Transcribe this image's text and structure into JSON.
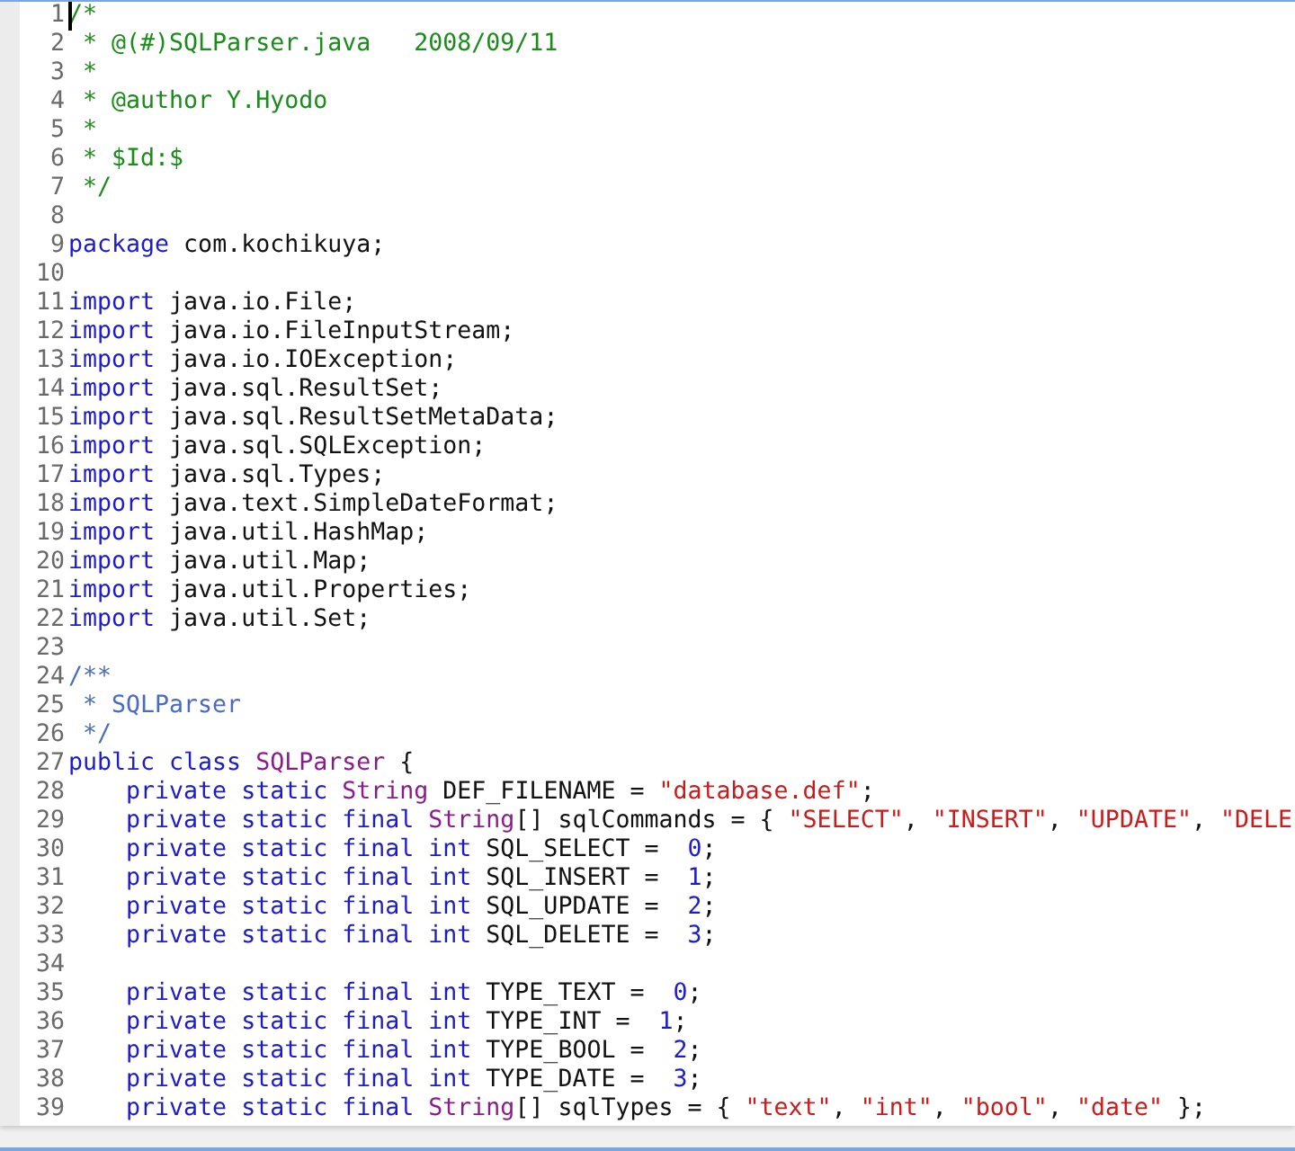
{
  "editor": {
    "caret": true,
    "lines": [
      {
        "number": "1",
        "tokens": [
          {
            "kind": "comment",
            "text": "/*"
          }
        ]
      },
      {
        "number": "2",
        "tokens": [
          {
            "kind": "comment",
            "text": " * @(#)SQLParser.java   2008/09/11"
          }
        ]
      },
      {
        "number": "3",
        "tokens": [
          {
            "kind": "comment",
            "text": " *"
          }
        ]
      },
      {
        "number": "4",
        "tokens": [
          {
            "kind": "comment",
            "text": " * @author Y.Hyodo"
          }
        ]
      },
      {
        "number": "5",
        "tokens": [
          {
            "kind": "comment",
            "text": " *"
          }
        ]
      },
      {
        "number": "6",
        "tokens": [
          {
            "kind": "comment",
            "text": " * $Id:$"
          }
        ]
      },
      {
        "number": "7",
        "tokens": [
          {
            "kind": "comment",
            "text": " */"
          }
        ]
      },
      {
        "number": "8"
      },
      {
        "number": "9",
        "tokens": [
          {
            "kind": "keyword",
            "text": "package"
          },
          {
            "kind": "plain",
            "text": " com.kochikuya;"
          }
        ]
      },
      {
        "number": "10"
      },
      {
        "number": "11",
        "tokens": [
          {
            "kind": "keyword",
            "text": "import"
          },
          {
            "kind": "plain",
            "text": " java.io.File;"
          }
        ]
      },
      {
        "number": "12",
        "tokens": [
          {
            "kind": "keyword",
            "text": "import"
          },
          {
            "kind": "plain",
            "text": " java.io.FileInputStream;"
          }
        ]
      },
      {
        "number": "13",
        "tokens": [
          {
            "kind": "keyword",
            "text": "import"
          },
          {
            "kind": "plain",
            "text": " java.io.IOException;"
          }
        ]
      },
      {
        "number": "14",
        "tokens": [
          {
            "kind": "keyword",
            "text": "import"
          },
          {
            "kind": "plain",
            "text": " java.sql.ResultSet;"
          }
        ]
      },
      {
        "number": "15",
        "tokens": [
          {
            "kind": "keyword",
            "text": "import"
          },
          {
            "kind": "plain",
            "text": " java.sql.ResultSetMetaData;"
          }
        ]
      },
      {
        "number": "16",
        "tokens": [
          {
            "kind": "keyword",
            "text": "import"
          },
          {
            "kind": "plain",
            "text": " java.sql.SQLException;"
          }
        ]
      },
      {
        "number": "17",
        "tokens": [
          {
            "kind": "keyword",
            "text": "import"
          },
          {
            "kind": "plain",
            "text": " java.sql.Types;"
          }
        ]
      },
      {
        "number": "18",
        "tokens": [
          {
            "kind": "keyword",
            "text": "import"
          },
          {
            "kind": "plain",
            "text": " java.text.SimpleDateFormat;"
          }
        ]
      },
      {
        "number": "19",
        "tokens": [
          {
            "kind": "keyword",
            "text": "import"
          },
          {
            "kind": "plain",
            "text": " java.util.HashMap;"
          }
        ]
      },
      {
        "number": "20",
        "tokens": [
          {
            "kind": "keyword",
            "text": "import"
          },
          {
            "kind": "plain",
            "text": " java.util.Map;"
          }
        ]
      },
      {
        "number": "21",
        "tokens": [
          {
            "kind": "keyword",
            "text": "import"
          },
          {
            "kind": "plain",
            "text": " java.util.Properties;"
          }
        ]
      },
      {
        "number": "22",
        "tokens": [
          {
            "kind": "keyword",
            "text": "import"
          },
          {
            "kind": "plain",
            "text": " java.util.Set;"
          }
        ]
      },
      {
        "number": "23"
      },
      {
        "number": "24",
        "tokens": [
          {
            "kind": "doc",
            "text": "/**"
          }
        ]
      },
      {
        "number": "25",
        "tokens": [
          {
            "kind": "doc",
            "text": " * SQLParser"
          }
        ]
      },
      {
        "number": "26",
        "tokens": [
          {
            "kind": "doc",
            "text": " */"
          }
        ]
      },
      {
        "number": "27",
        "tokens": [
          {
            "kind": "keyword",
            "text": "public class "
          },
          {
            "kind": "type",
            "text": "SQLParser"
          },
          {
            "kind": "plain",
            "text": " {"
          }
        ]
      },
      {
        "number": "28",
        "tokens": [
          {
            "kind": "keyword",
            "text": "    private static "
          },
          {
            "kind": "type",
            "text": "String"
          },
          {
            "kind": "plain",
            "text": " DEF_FILENAME = "
          },
          {
            "kind": "string",
            "text": "\"database.def\""
          },
          {
            "kind": "plain",
            "text": ";"
          }
        ]
      },
      {
        "number": "29",
        "tokens": [
          {
            "kind": "keyword",
            "text": "    private static final "
          },
          {
            "kind": "type",
            "text": "String"
          },
          {
            "kind": "plain",
            "text": "[] sqlCommands = { "
          },
          {
            "kind": "string",
            "text": "\"SELECT\""
          },
          {
            "kind": "plain",
            "text": ", "
          },
          {
            "kind": "string",
            "text": "\"INSERT\""
          },
          {
            "kind": "plain",
            "text": ", "
          },
          {
            "kind": "string",
            "text": "\"UPDATE\""
          },
          {
            "kind": "plain",
            "text": ", "
          },
          {
            "kind": "string",
            "text": "\"DELE"
          }
        ]
      },
      {
        "number": "30",
        "tokens": [
          {
            "kind": "keyword",
            "text": "    private static final int"
          },
          {
            "kind": "plain",
            "text": " SQL_SELECT =  "
          },
          {
            "kind": "number",
            "text": "0"
          },
          {
            "kind": "plain",
            "text": ";"
          }
        ]
      },
      {
        "number": "31",
        "tokens": [
          {
            "kind": "keyword",
            "text": "    private static final int"
          },
          {
            "kind": "plain",
            "text": " SQL_INSERT =  "
          },
          {
            "kind": "number",
            "text": "1"
          },
          {
            "kind": "plain",
            "text": ";"
          }
        ]
      },
      {
        "number": "32",
        "tokens": [
          {
            "kind": "keyword",
            "text": "    private static final int"
          },
          {
            "kind": "plain",
            "text": " SQL_UPDATE =  "
          },
          {
            "kind": "number",
            "text": "2"
          },
          {
            "kind": "plain",
            "text": ";"
          }
        ]
      },
      {
        "number": "33",
        "tokens": [
          {
            "kind": "keyword",
            "text": "    private static final int"
          },
          {
            "kind": "plain",
            "text": " SQL_DELETE =  "
          },
          {
            "kind": "number",
            "text": "3"
          },
          {
            "kind": "plain",
            "text": ";"
          }
        ]
      },
      {
        "number": "34"
      },
      {
        "number": "35",
        "tokens": [
          {
            "kind": "keyword",
            "text": "    private static final int"
          },
          {
            "kind": "plain",
            "text": " TYPE_TEXT =  "
          },
          {
            "kind": "number",
            "text": "0"
          },
          {
            "kind": "plain",
            "text": ";"
          }
        ]
      },
      {
        "number": "36",
        "tokens": [
          {
            "kind": "keyword",
            "text": "    private static final int"
          },
          {
            "kind": "plain",
            "text": " TYPE_INT =  "
          },
          {
            "kind": "number",
            "text": "1"
          },
          {
            "kind": "plain",
            "text": ";"
          }
        ]
      },
      {
        "number": "37",
        "tokens": [
          {
            "kind": "keyword",
            "text": "    private static final int"
          },
          {
            "kind": "plain",
            "text": " TYPE_BOOL =  "
          },
          {
            "kind": "number",
            "text": "2"
          },
          {
            "kind": "plain",
            "text": ";"
          }
        ]
      },
      {
        "number": "38",
        "tokens": [
          {
            "kind": "keyword",
            "text": "    private static final int"
          },
          {
            "kind": "plain",
            "text": " TYPE_DATE =  "
          },
          {
            "kind": "number",
            "text": "3"
          },
          {
            "kind": "plain",
            "text": ";"
          }
        ]
      },
      {
        "number": "39",
        "tokens": [
          {
            "kind": "keyword",
            "text": "    private static final "
          },
          {
            "kind": "type",
            "text": "String"
          },
          {
            "kind": "plain",
            "text": "[] sqlTypes = { "
          },
          {
            "kind": "string",
            "text": "\"text\""
          },
          {
            "kind": "plain",
            "text": ", "
          },
          {
            "kind": "string",
            "text": "\"int\""
          },
          {
            "kind": "plain",
            "text": ", "
          },
          {
            "kind": "string",
            "text": "\"bool\""
          },
          {
            "kind": "plain",
            "text": ", "
          },
          {
            "kind": "string",
            "text": "\"date\""
          },
          {
            "kind": "plain",
            "text": " };"
          }
        ]
      }
    ]
  }
}
